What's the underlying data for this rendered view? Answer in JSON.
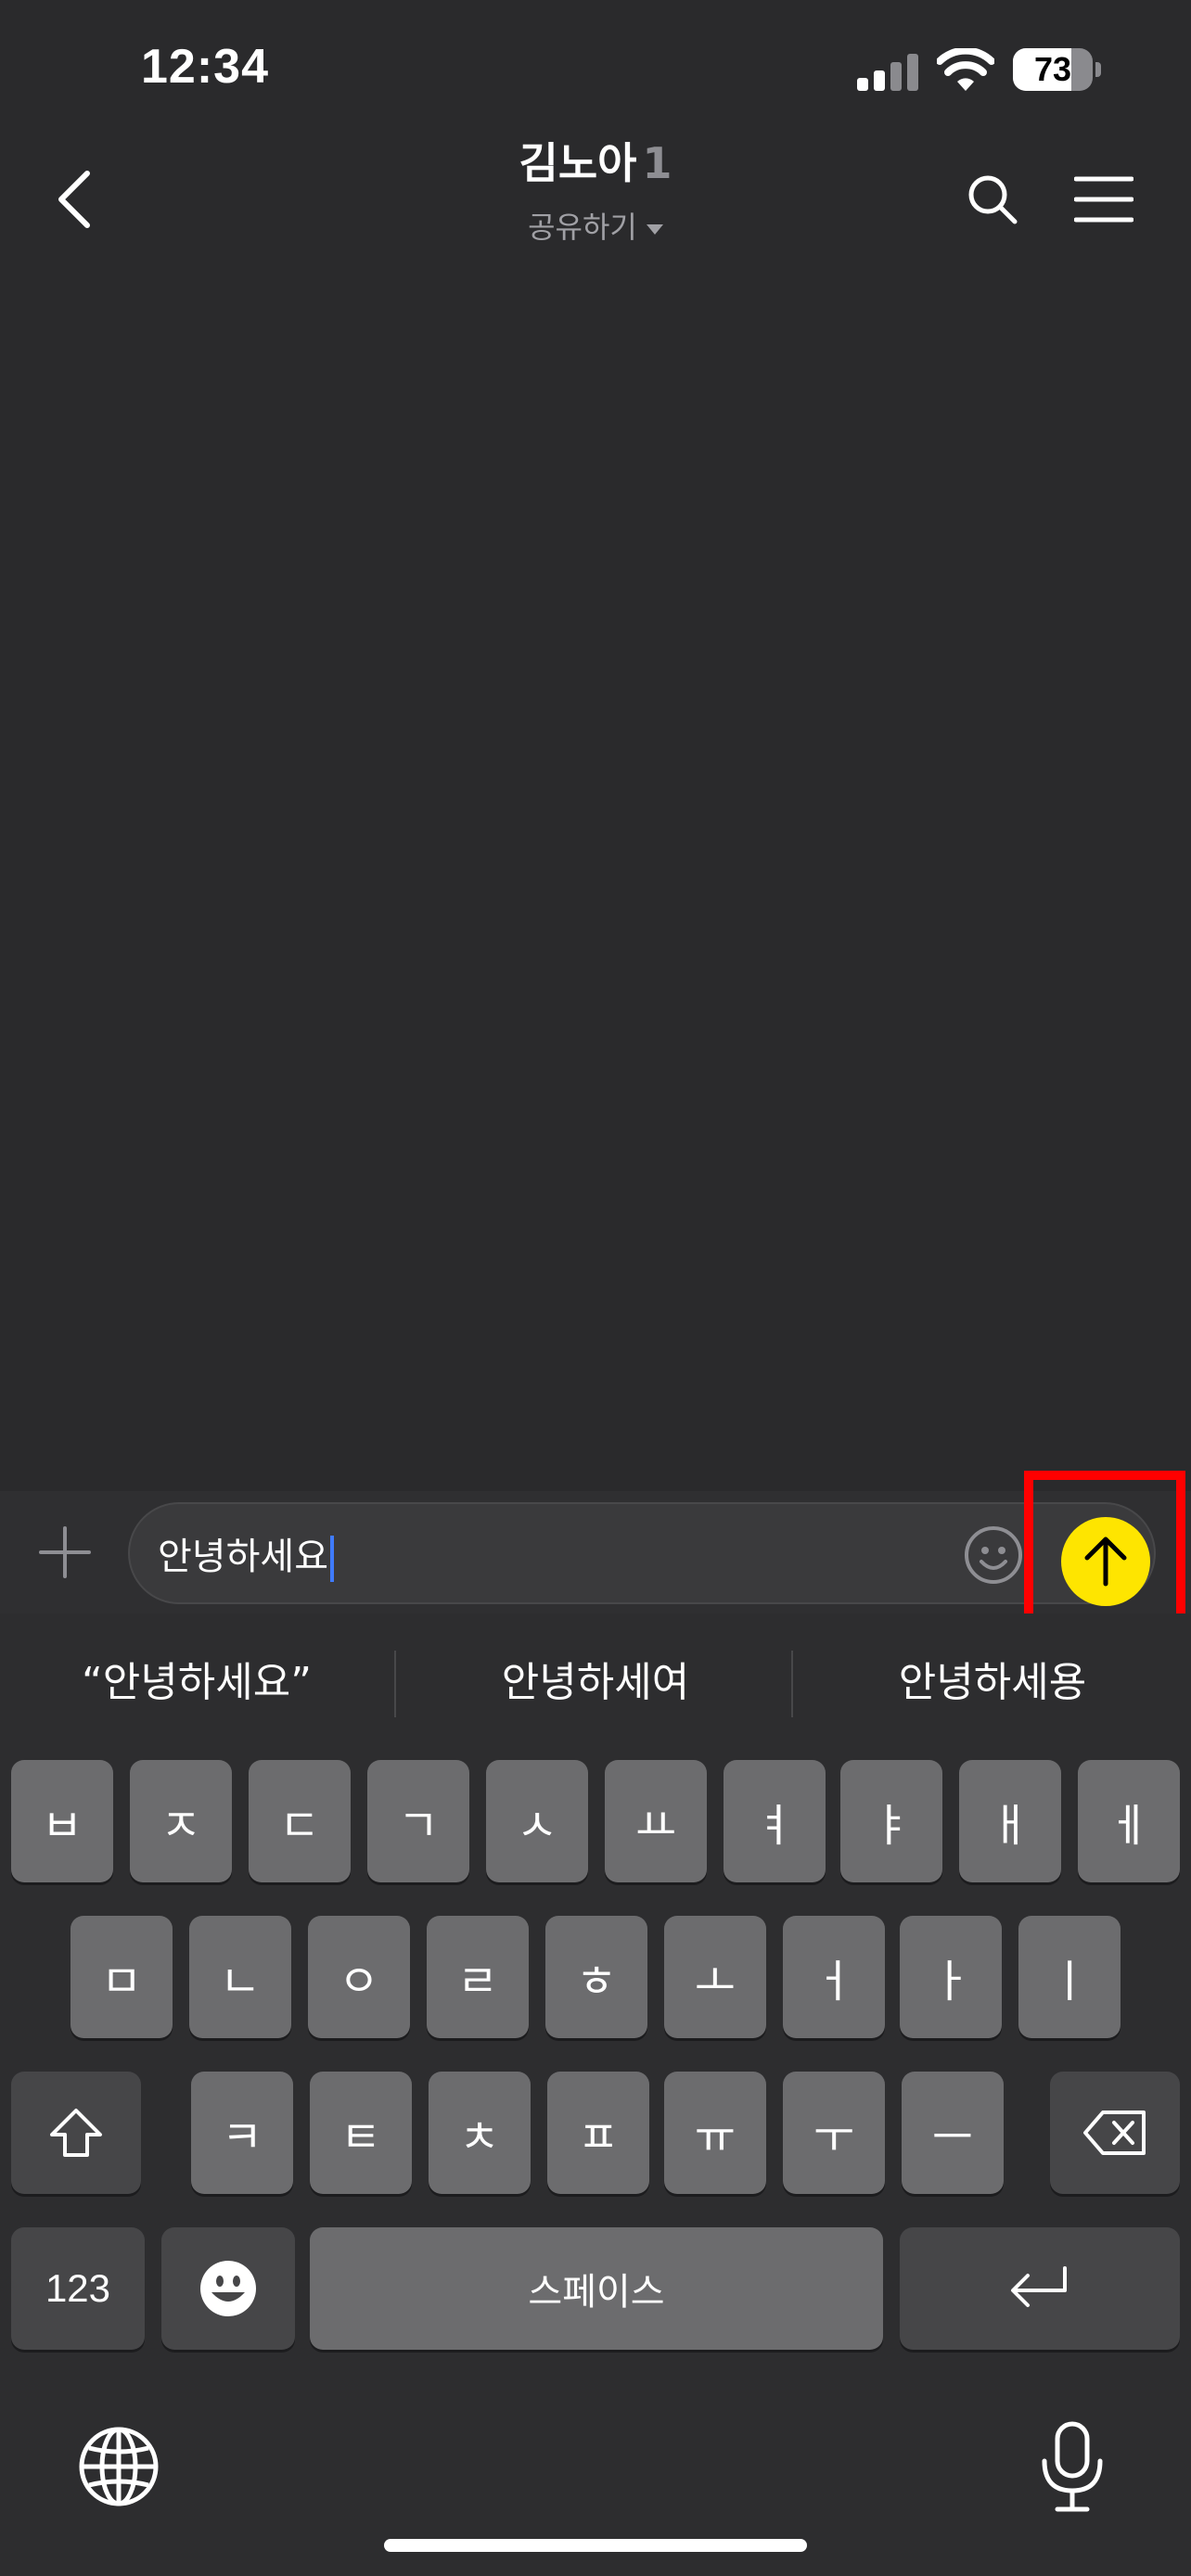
{
  "status_bar": {
    "time": "12:34",
    "battery_level": "73",
    "battery_fraction": 0.73
  },
  "header": {
    "title": "김노아",
    "member_count": "1",
    "share_label": "공유하기"
  },
  "input": {
    "value": "안녕하세요"
  },
  "keyboard": {
    "suggestions": [
      "“안녕하세요”",
      "안녕하세여",
      "안녕하세용"
    ],
    "row1": [
      "ㅂ",
      "ㅈ",
      "ㄷ",
      "ㄱ",
      "ㅅ",
      "ㅛ",
      "ㅕ",
      "ㅑ",
      "ㅐ",
      "ㅔ"
    ],
    "row2": [
      "ㅁ",
      "ㄴ",
      "ㅇ",
      "ㄹ",
      "ㅎ",
      "ㅗ",
      "ㅓ",
      "ㅏ",
      "ㅣ"
    ],
    "row3": [
      "ㅋ",
      "ㅌ",
      "ㅊ",
      "ㅍ",
      "ㅠ",
      "ㅜ",
      "ㅡ"
    ],
    "numbers_label": "123",
    "space_label": "스페이스"
  },
  "colors": {
    "send_button": "#fee500",
    "highlight": "#ff0000",
    "caret": "#3f7bff"
  }
}
